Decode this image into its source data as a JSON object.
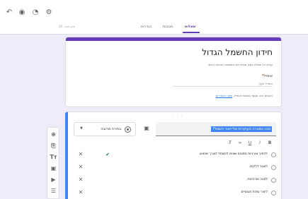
{
  "toolbar": {
    "icons": [
      "undo-icon",
      "preview-eye-icon",
      "palette-icon",
      "addon-puzzle-icon"
    ]
  },
  "header": {
    "tabs": [
      {
        "label": "שאלות",
        "active": true
      },
      {
        "label": "תגובות",
        "active": false
      },
      {
        "label": "הגדרות",
        "active": false
      }
    ],
    "saved_note": "ציון מרבי: 10"
  },
  "form": {
    "title": "חידון החשמל הגדול",
    "description": "קראו כל שאלה בעיון ובחרו את התשובה הנכונה ביותר.",
    "email_label": "אימייל",
    "email_required_mark": "*",
    "email_placeholder": "אימייל תקין",
    "email_note": "הטופס הזה אוסף כתובות אימייל.",
    "email_settings_link": "שינוי ההגדרות"
  },
  "question": {
    "drag_handle": "⋮⋮⋮",
    "text": "מהו המטרה העיקרית של ייצור חשמל?",
    "type_label": "בחירה מרובה",
    "options": [
      {
        "label": "להפוך אנרגיות מסוגים שונים לחשמל לצורך שימוש.",
        "correct": true
      },
      {
        "label": "לאגור דלקים.",
        "correct": false
      },
      {
        "label": "לסבב טורבינות.",
        "correct": false
      },
      {
        "label": "ליצור שדות מגנטיים.",
        "correct": false
      }
    ]
  },
  "side_toolbar": {
    "buttons": [
      "add-question-icon",
      "import-questions-icon",
      "add-title-icon",
      "add-image-icon",
      "add-video-icon",
      "add-section-icon"
    ]
  },
  "colors": {
    "accent": "#673ab7",
    "background": "#f0ebf8",
    "focus": "#4285f4",
    "correct": "#188038"
  }
}
